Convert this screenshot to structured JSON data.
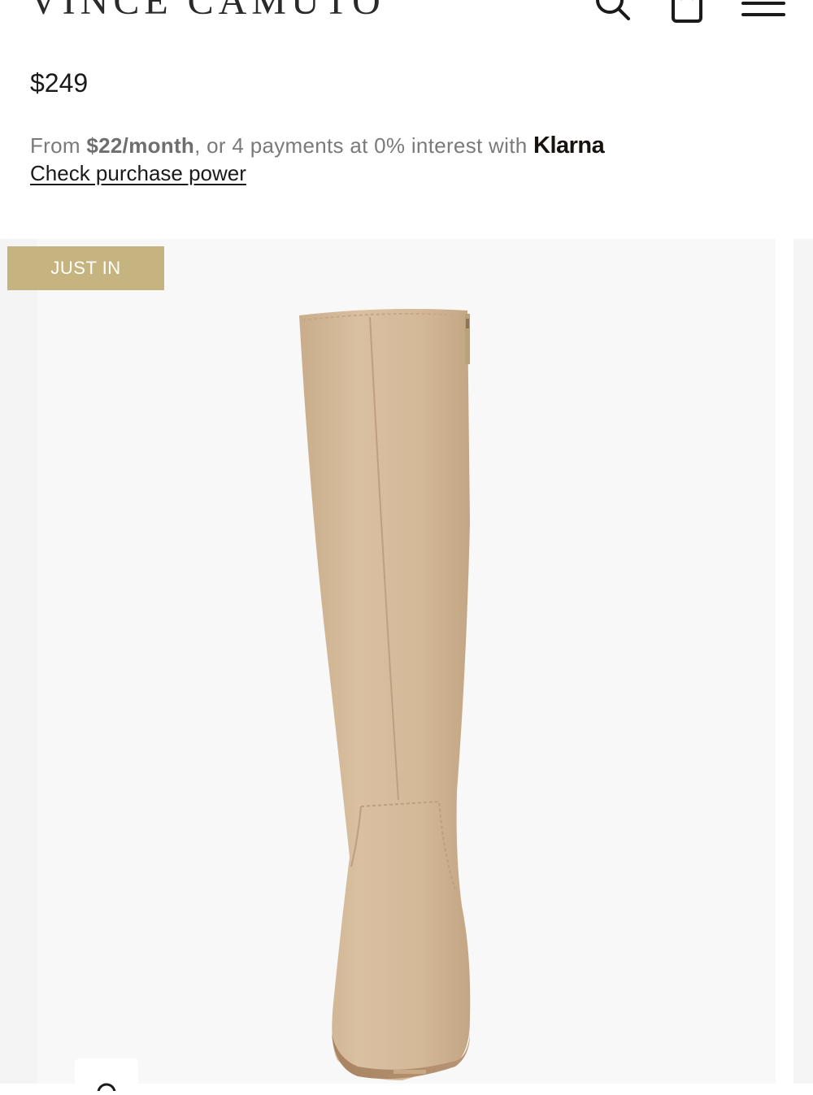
{
  "header": {
    "logo_text": "VINCE CAMUTO",
    "icons": {
      "search": "search-icon",
      "bag": "shopping-bag-icon",
      "menu": "hamburger-menu-icon"
    }
  },
  "product": {
    "price": "$249"
  },
  "klarna": {
    "prefix": "From ",
    "amount": "$22/month",
    "suffix": ", or 4 payments at 0% interest with ",
    "brand": "Klarna",
    "link_label": "Check purchase power"
  },
  "gallery": {
    "badge": "JUST IN",
    "zoom_icon": "zoom-icon"
  },
  "colors": {
    "badge_bg": "#c5b47f",
    "suede": "#d6bc9c",
    "klarna_text": "#7a7a7a"
  }
}
